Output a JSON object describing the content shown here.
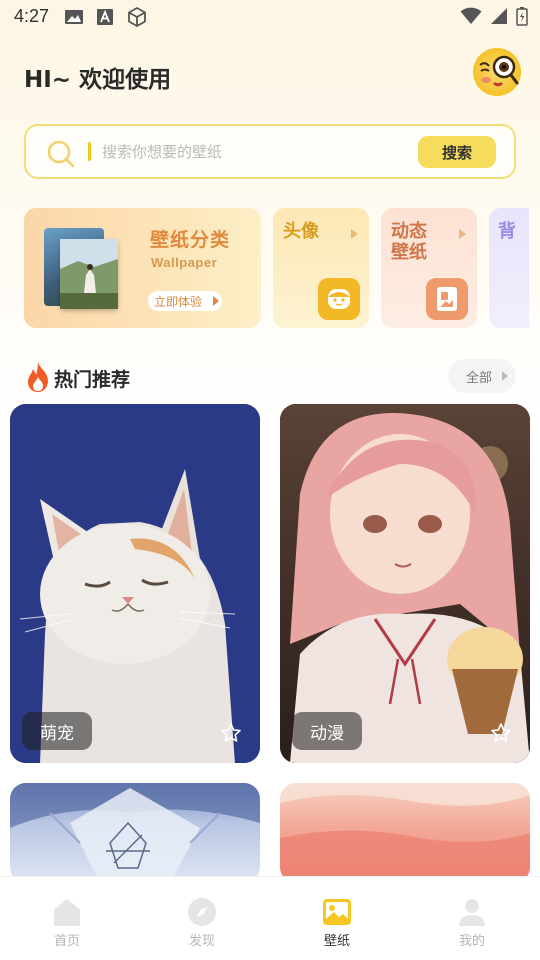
{
  "status_bar": {
    "time": "4:27"
  },
  "header": {
    "greeting": "HI~ 欢迎使用"
  },
  "search": {
    "placeholder": "搜索你想要的壁纸",
    "button_label": "搜索"
  },
  "categories": {
    "wallpaper": {
      "title": "壁纸分类",
      "subtitle": "Wallpaper",
      "cta": "立即体验"
    },
    "avatar": {
      "title": "头像"
    },
    "live": {
      "title_line1": "动态",
      "title_line2": "壁纸"
    },
    "background": {
      "title": "背"
    }
  },
  "section": {
    "title": "热门推荐",
    "all_label": "全部"
  },
  "tiles": [
    {
      "label": "萌宠"
    },
    {
      "label": "动漫"
    }
  ],
  "bottom_nav": {
    "items": [
      {
        "label": "首页",
        "icon": "home-icon",
        "active": false
      },
      {
        "label": "发现",
        "icon": "compass-icon",
        "active": false
      },
      {
        "label": "壁纸",
        "icon": "wallpaper-icon",
        "active": true
      },
      {
        "label": "我的",
        "icon": "profile-icon",
        "active": false
      }
    ]
  },
  "colors": {
    "accent_yellow": "#f6dc5c",
    "search_border": "#f3dd78",
    "wallpaper_title": "#e08a3e",
    "avatar_title": "#d89d20",
    "live_title": "#d0764a",
    "nav_active": "#333333",
    "nav_inactive": "#b5b5b5"
  }
}
